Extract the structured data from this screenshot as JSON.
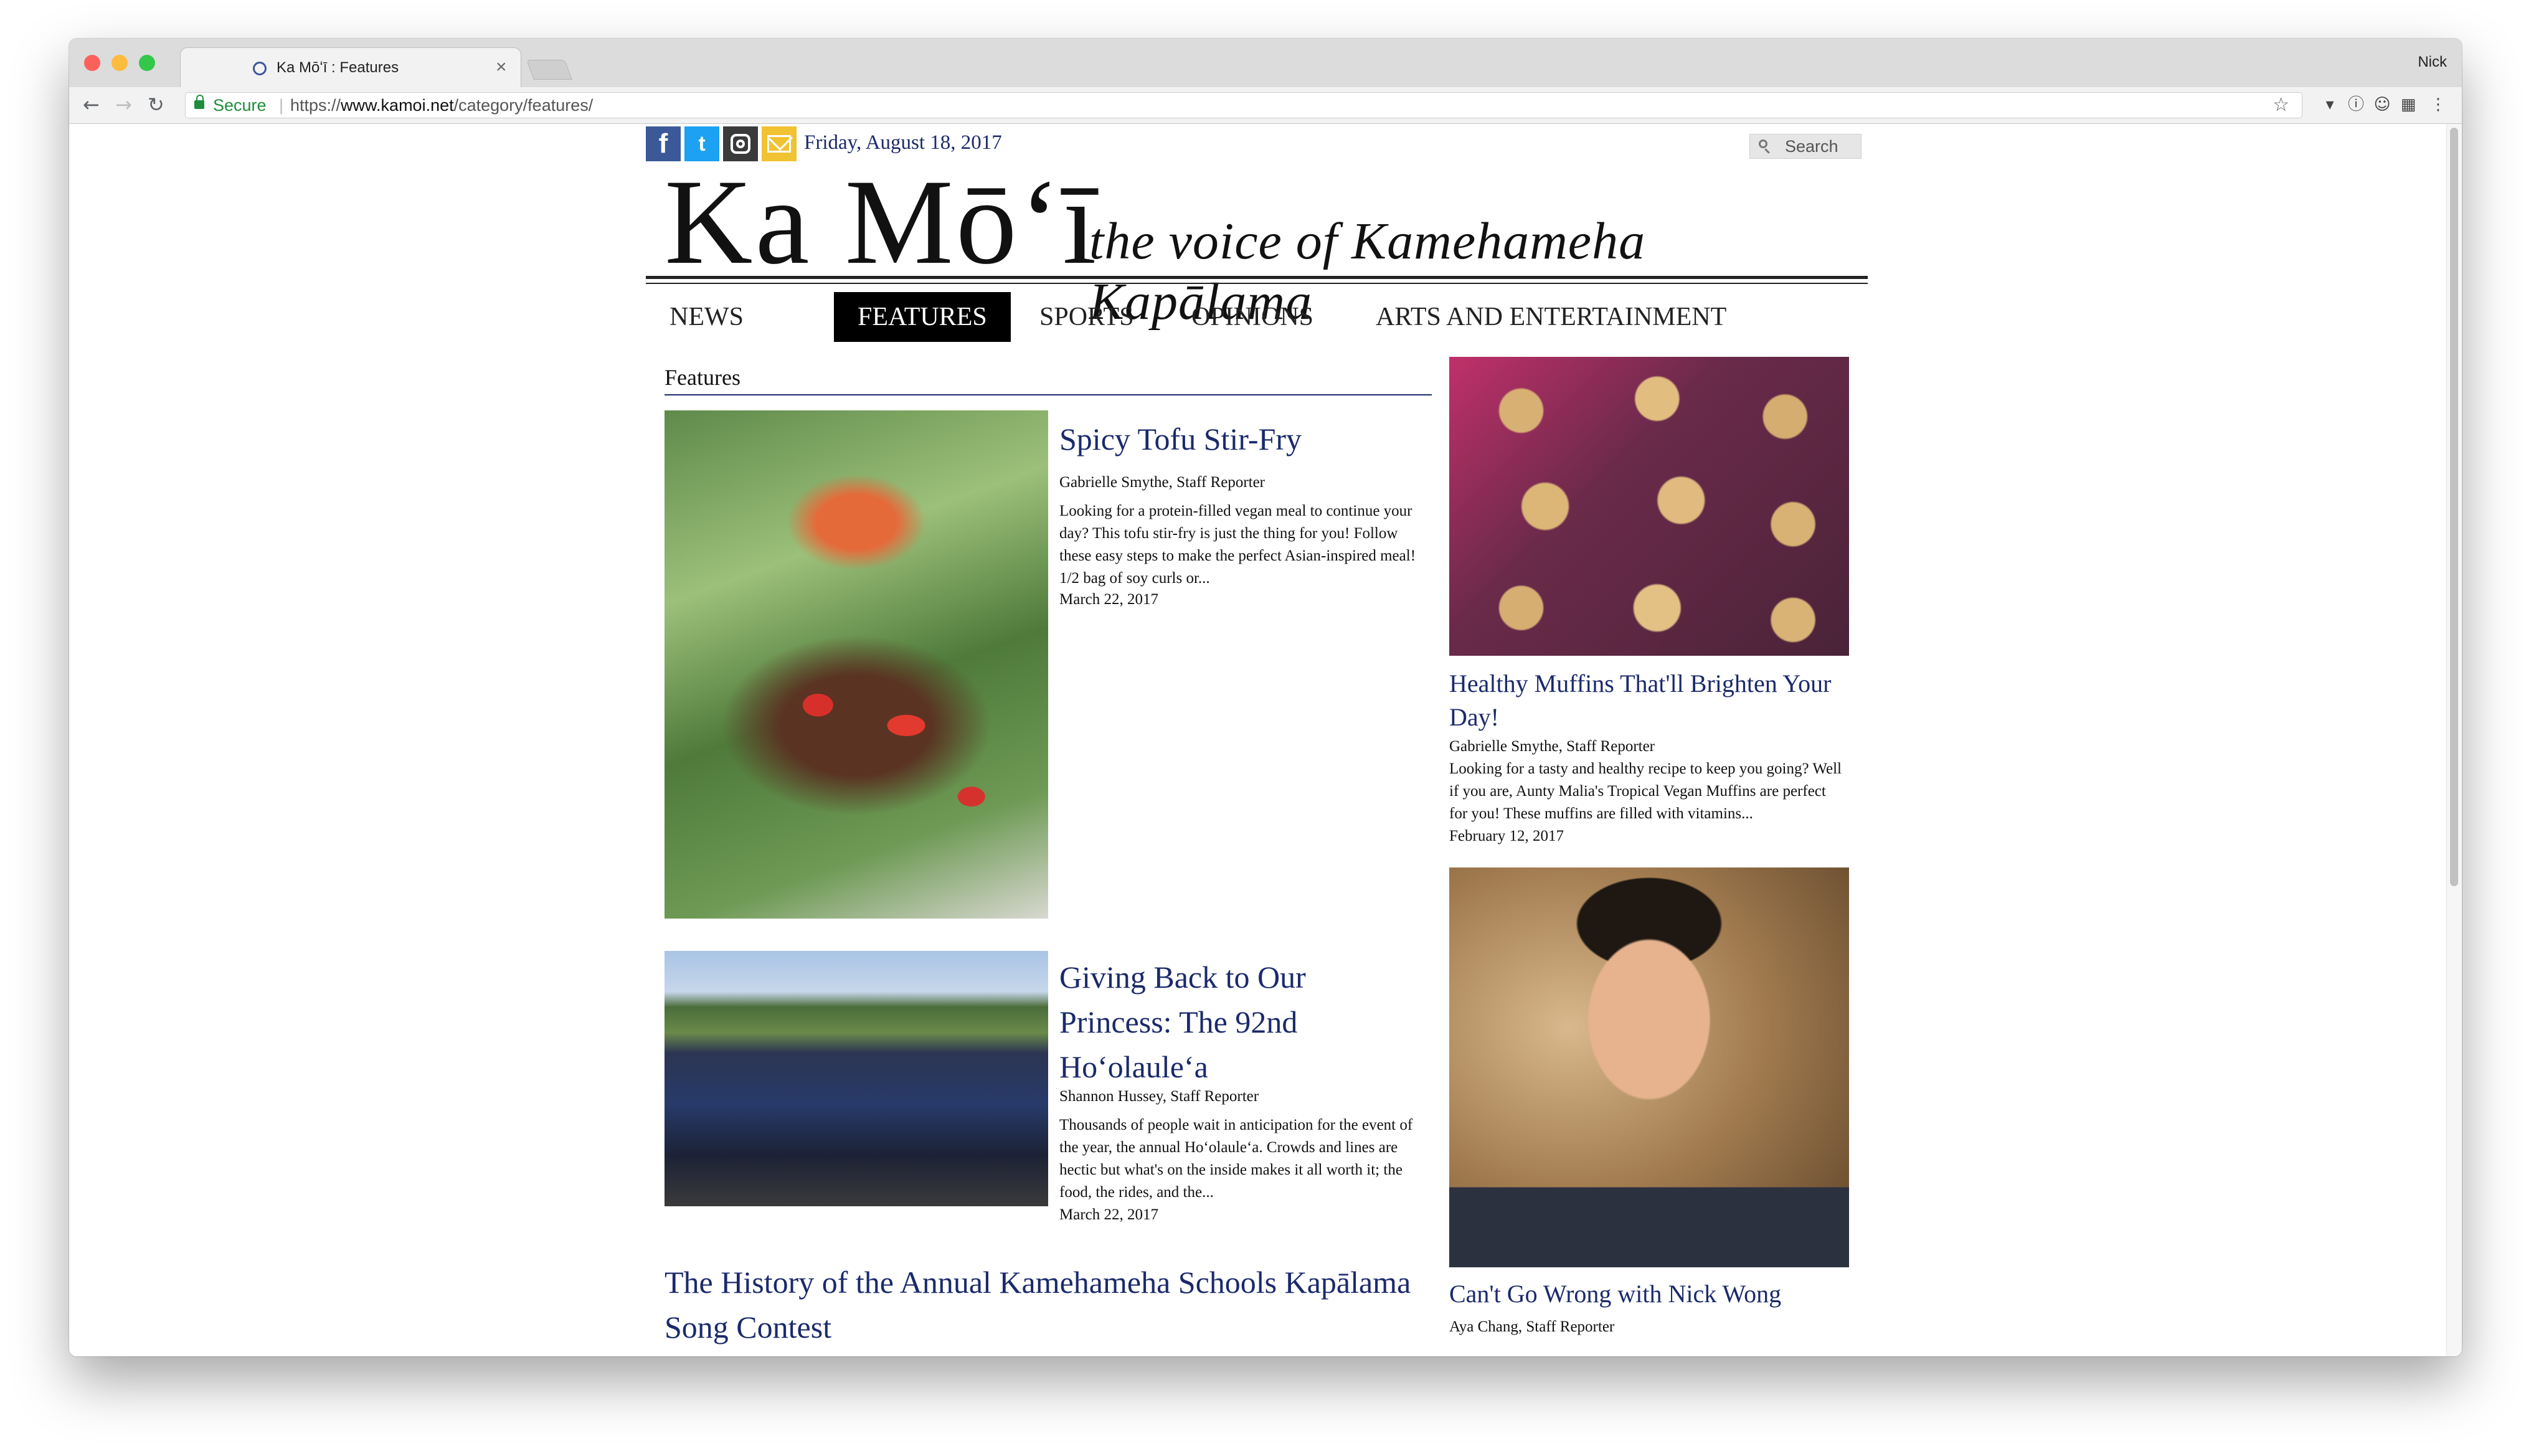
{
  "browser": {
    "tab_title": "Ka Mōʻī : Features",
    "tab_close": "×",
    "profile_name": "Nick",
    "secure_label": "Secure",
    "url_scheme": "https://",
    "url_host": "www.kamoi.net",
    "url_path": "/category/features/",
    "icons": [
      "back-arrow-icon",
      "forward-arrow-icon",
      "reload-icon",
      "lock-icon",
      "star-icon",
      "pocket-icon",
      "info-icon",
      "ghostery-icon",
      "extension-icon",
      "menu-dots-icon"
    ]
  },
  "site": {
    "date": "Friday, August 18, 2017",
    "search_label": "Search",
    "masthead": "Ka Mōʻī",
    "tagline": "the voice of Kamehameha Kapālama",
    "social": [
      "facebook-icon",
      "twitter-icon",
      "instagram-icon",
      "email-icon"
    ],
    "colors": {
      "link": "#1b2a6b",
      "nav_active_bg": "#000000",
      "facebook": "#3b5998",
      "twitter": "#1da1f2",
      "email": "#f1c232"
    }
  },
  "nav": {
    "items": [
      "NEWS",
      "FEATURES",
      "SPORTS",
      "OPINIONS",
      "ARTS AND ENTERTAINMENT"
    ],
    "active": "FEATURES"
  },
  "section_title": "Features",
  "articles": [
    {
      "title": "Spicy Tofu Stir-Fry",
      "byline": "Gabrielle Smythe, Staff Reporter",
      "excerpt": "Looking for a protein-filled vegan meal to continue your day? This tofu stir-fry is just the thing for you! Follow these easy steps to make the perfect Asian-inspired meal! 1/2 bag of soy curls or...",
      "date": "March 22, 2017"
    },
    {
      "title": "Giving Back to Our Princess: The 92nd Hoʻolauleʻa",
      "byline": "Shannon Hussey, Staff Reporter",
      "excerpt": "Thousands of people wait in anticipation for the event of the year, the annual Hoʻolauleʻa. Crowds and lines are hectic but what's on the inside makes it all worth it; the food, the rides, and the...",
      "date": "March 22, 2017"
    },
    {
      "title": "The History of the Annual Kamehameha Schools Kapālama Song Contest"
    }
  ],
  "sidebar": [
    {
      "title": "Healthy Muffins That'll Brighten Your Day!",
      "byline": "Gabrielle Smythe, Staff Reporter",
      "excerpt": "Looking for a tasty and healthy recipe to keep you going? Well if you are, Aunty Malia's Tropical Vegan Muffins are perfect for you! These muffins are filled with vitamins...",
      "date": "February 12, 2017"
    },
    {
      "title": "Can't Go Wrong with Nick Wong",
      "byline": "Aya Chang, Staff Reporter"
    }
  ]
}
